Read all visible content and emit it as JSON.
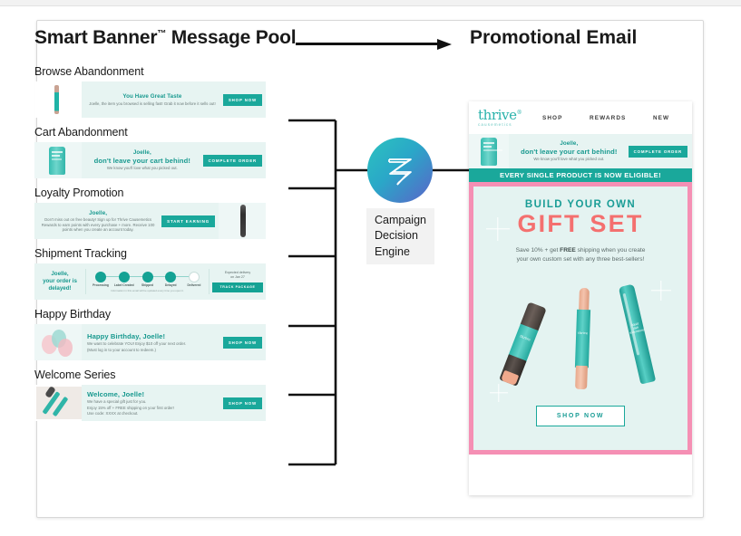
{
  "header": {
    "left_title": "Smart Banner",
    "trademark": "™",
    "left_title_tail": " Message Pool",
    "right_title": "Promotional Email",
    "arrow": "right-arrow"
  },
  "engine": {
    "label": "Campaign\nDecision\nEngine",
    "label_lines": [
      "Campaign",
      "Decision",
      "Engine"
    ],
    "logo_icon": "zeta-loop-logo",
    "gradient_from": "#2cc3bf",
    "gradient_to": "#5b63c9"
  },
  "colors": {
    "banner_bg": "#e7f4f2",
    "teal": "#1aa89b",
    "teal_text": "#18998f",
    "pink_frame": "#f58fb4",
    "coral": "#f4706f",
    "hero_bg": "#e4f3f1"
  },
  "pool": [
    {
      "label": "Browse Abandonment",
      "headline": "You Have Great Taste",
      "body": "Joelle, the item you browsed is selling fast! Grab it now before it sells out!",
      "cta": "SHOP NOW",
      "product_art": "eyeliner-pencil"
    },
    {
      "label": "Cart Abandonment",
      "headline_pre": "Joelle,",
      "headline": "don't leave your cart behind!",
      "body": "We know you'll love what you picked out.",
      "cta": "COMPLETE ORDER",
      "product_art": "skincare-tube"
    },
    {
      "label": "Loyalty Promotion",
      "headline": "Joelle,",
      "body": "Don't miss out on free beauty! Sign up for Thrive Causemetics Rewards to earn points with every purchase + more. Receive 100 points when you create an account today.",
      "cta": "START EARNING",
      "product_art": "mascara-wand"
    },
    {
      "label": "Shipment Tracking",
      "headline": "Joelle,\nyour order is\ndelayed!",
      "headline_lines": [
        "Joelle,",
        "your order is",
        "delayed!"
      ],
      "steps": [
        {
          "name": "Processing",
          "done": true
        },
        {
          "name": "Label Created",
          "done": true
        },
        {
          "name": "Shipped",
          "done": true
        },
        {
          "name": "Delayed",
          "done": true
        },
        {
          "name": "Delivered",
          "done": false
        }
      ],
      "note": "Information in this email will be updated every time you open it.",
      "eta_label": "Expected delivery",
      "eta_value": "on Jan 27",
      "cta": "TRACK PACKAGE",
      "product_art": "none"
    },
    {
      "label": "Happy Birthday",
      "headline": "Happy Birthday, Joelle!",
      "body": "We want to celebrate YOU! Enjoy $10 off your next order.",
      "body2": "(Must log in to your account to redeem.)",
      "cta": "SHOP NOW",
      "product_art": "balloons"
    },
    {
      "label": "Welcome Series",
      "headline": "Welcome, Joelle!",
      "body": "We have a special gift just for you.",
      "body2": "Enjoy 15% off + FREE shipping on your first order!",
      "body3": "Use code: XXXX at checkout.",
      "cta": "SHOP NOW",
      "product_art": "brushes"
    }
  ],
  "email": {
    "brand": {
      "name": "thrive",
      "tm": "®",
      "sub": "causemetics"
    },
    "nav": [
      "SHOP",
      "REWARDS",
      "NEW"
    ],
    "cart_banner": {
      "line1": "Joelle,",
      "line2": "don't leave your cart behind!",
      "line3": "We know you'll love what you picked out.",
      "cta": "COMPLETE ORDER"
    },
    "eligible_bar": "EVERY SINGLE PRODUCT IS NOW ELIGIBLE!",
    "hero": {
      "kicker": "BUILD YOUR OWN",
      "title": "GIFT SET",
      "sub_line1_a": "Save 10% + get ",
      "sub_line1_b": "FREE",
      "sub_line1_c": " shipping when you create",
      "sub_line2": "your own custom set with any three best-sellers!",
      "cta": "SHOP NOW",
      "products": [
        "thrive",
        "thrive",
        "liquid lash extensions"
      ]
    }
  }
}
